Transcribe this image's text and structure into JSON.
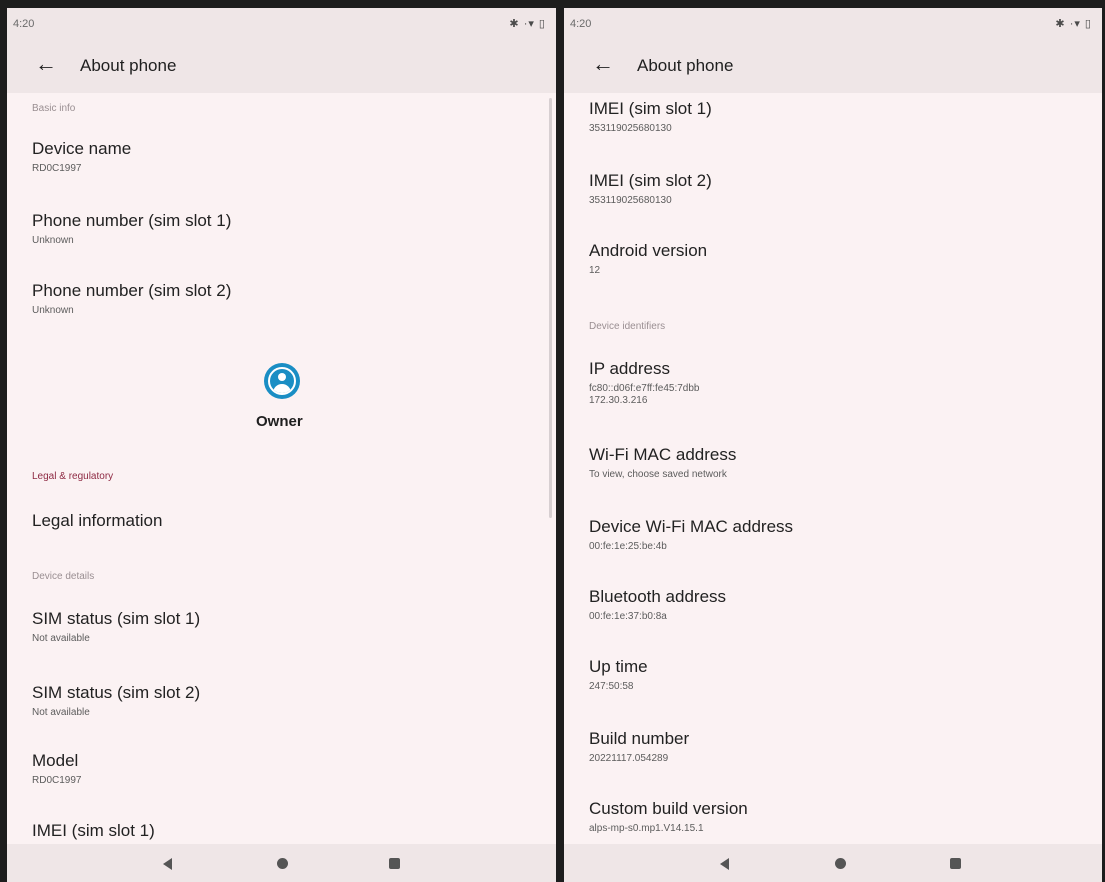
{
  "left": {
    "status": {
      "time": "4:20",
      "icons": "✱ ·▾ ▯"
    },
    "app_bar": {
      "title": "About phone"
    },
    "sections": {
      "basic_info": "Basic info",
      "legal": "Legal & regulatory",
      "device_details": "Device details"
    },
    "items": {
      "device_name": {
        "title": "Device name",
        "sub": "RD0C1997"
      },
      "phone_number_1": {
        "title": "Phone number (sim slot 1)",
        "sub": "Unknown"
      },
      "phone_number_2": {
        "title": "Phone number (sim slot 2)",
        "sub": "Unknown"
      },
      "legal_info": {
        "title": "Legal information"
      },
      "sim_status_1": {
        "title": "SIM status (sim slot 1)",
        "sub": "Not available"
      },
      "sim_status_2": {
        "title": "SIM status (sim slot 2)",
        "sub": "Not available"
      },
      "model": {
        "title": "Model",
        "sub": "RD0C1997"
      },
      "imei_1": {
        "title": "IMEI (sim slot 1)"
      }
    },
    "owner": {
      "label": "Owner",
      "icon": "account-circle-icon"
    }
  },
  "right": {
    "status": {
      "time": "4:20",
      "icons": "✱ ·▾ ▯"
    },
    "app_bar": {
      "title": "About phone"
    },
    "sections": {
      "device_identifiers": "Device identifiers"
    },
    "items": {
      "imei_1": {
        "title": "IMEI (sim slot 1)",
        "sub": "353119025680130"
      },
      "imei_2": {
        "title": "IMEI (sim slot 2)",
        "sub": "353119025680130"
      },
      "android_version": {
        "title": "Android version",
        "sub": "12"
      },
      "ip_address": {
        "title": "IP address",
        "sub": "fc80::d06f:e7ff:fe45:7dbb",
        "sub2": "172.30.3.216"
      },
      "wifi_mac": {
        "title": "Wi-Fi MAC address",
        "sub": "To view, choose saved network"
      },
      "device_wifi_mac": {
        "title": "Device Wi-Fi MAC address",
        "sub": "00:fe:1e:25:be:4b"
      },
      "bluetooth": {
        "title": "Bluetooth address",
        "sub": "00:fe:1e:37:b0:8a"
      },
      "uptime": {
        "title": "Up time",
        "sub": "247:50:58"
      },
      "build_number": {
        "title": "Build number",
        "sub": "20221117.054289"
      },
      "custom_build": {
        "title": "Custom build version",
        "sub": "alps-mp-s0.mp1.V14.15.1"
      }
    }
  },
  "nav": {
    "back": "back-triangle-icon",
    "home": "home-circle-icon",
    "recents": "recents-square-icon"
  },
  "colors": {
    "accent": "#8e2a43",
    "owner_icon": "#1a8ec4",
    "background": "#fbf2f3",
    "bar": "#efe6e7"
  }
}
